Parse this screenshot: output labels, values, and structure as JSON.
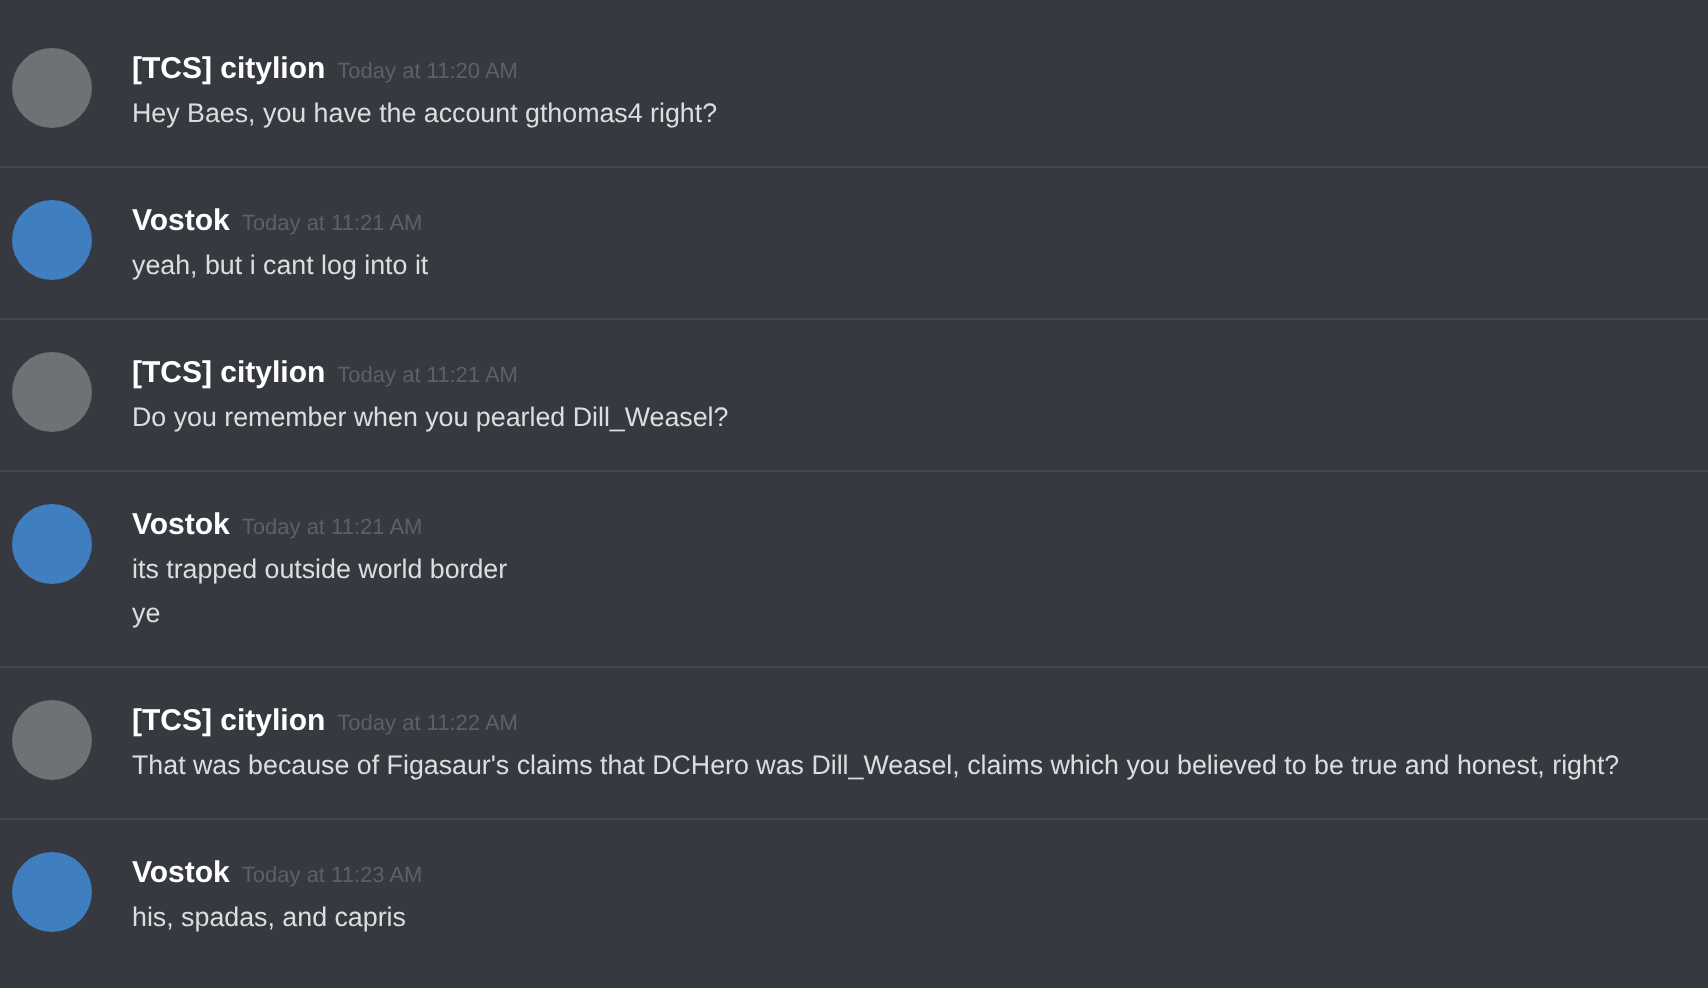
{
  "messages": [
    {
      "author": "[TCS] citylion",
      "timestamp": "Today at 11:20 AM",
      "color": "#6d7274",
      "lines": [
        "Hey Baes, you have the account gthomas4 right?"
      ]
    },
    {
      "author": "Vostok",
      "timestamp": "Today at 11:21 AM",
      "color": "#3f7fc0",
      "lines": [
        "yeah, but i cant log into it"
      ]
    },
    {
      "author": "[TCS] citylion",
      "timestamp": "Today at 11:21 AM",
      "color": "#6d7274",
      "lines": [
        "Do you remember when you pearled Dill_Weasel?"
      ]
    },
    {
      "author": "Vostok",
      "timestamp": "Today at 11:21 AM",
      "color": "#3f7fc0",
      "lines": [
        "its trapped outside world border",
        "ye"
      ]
    },
    {
      "author": "[TCS] citylion",
      "timestamp": "Today at 11:22 AM",
      "color": "#6d7274",
      "lines": [
        "That was because of Figasaur's claims that DCHero was Dill_Weasel, claims which you believed to be true and honest, right?"
      ]
    },
    {
      "author": "Vostok",
      "timestamp": "Today at 11:23 AM",
      "color": "#3f7fc0",
      "lines": [
        "his, spadas, and capris"
      ]
    }
  ]
}
